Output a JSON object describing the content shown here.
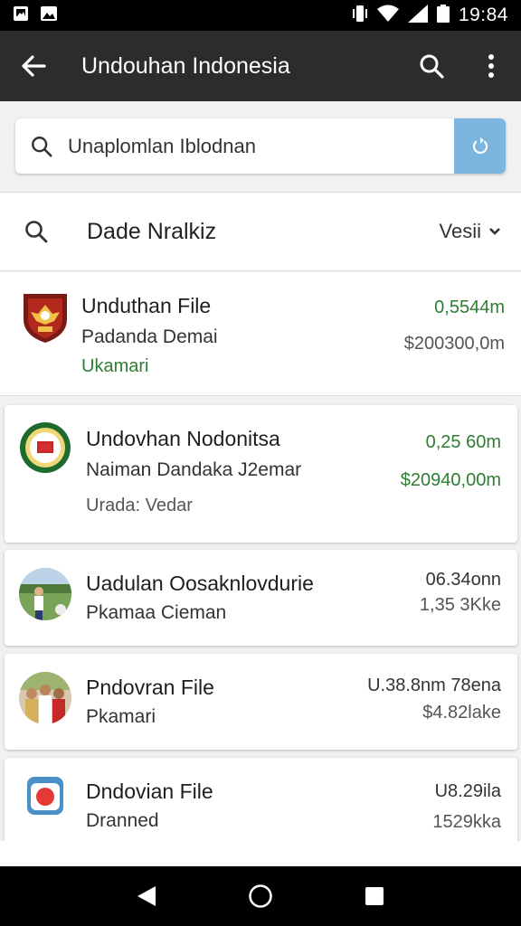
{
  "status_bar": {
    "time": "19:84"
  },
  "app_bar": {
    "title": "Undouhan Indonesia"
  },
  "search": {
    "value": "Unaplomlan Iblodnan"
  },
  "filter": {
    "label": "Dade Nralkiz",
    "select_value": "Vesii"
  },
  "items": [
    {
      "title": "Unduthan File",
      "subtitle": "Padanda Demai",
      "meta": "Ukamari",
      "value_top": "0,5544m",
      "value_bottom": "$200300,0m"
    },
    {
      "title": "Undovhan Nodonitsa",
      "subtitle": "Naiman Dandaka J2emar",
      "meta": "Urada: Vedar",
      "value_top": "0,25 60m",
      "value_bottom": "$20940,00m"
    },
    {
      "title": "Uadulan Oosaknlovdurie",
      "subtitle": "Pkamaa Cieman",
      "value_top": "06.34onn",
      "value_bottom": "1,35 3Kke"
    },
    {
      "title": "Pndovran File",
      "subtitle": "Pkamari",
      "value_top": "U.38.8nm 78ena",
      "value_bottom": "$4.82lake"
    },
    {
      "title": "Dndovian File",
      "subtitle": "Dranned",
      "value_top": "U8.29ila",
      "value_bottom": "1529kka"
    }
  ],
  "colors": {
    "app_bar": "#2c2c2c",
    "accent_blue": "#7cb6de",
    "value_green": "#2e7d32"
  }
}
